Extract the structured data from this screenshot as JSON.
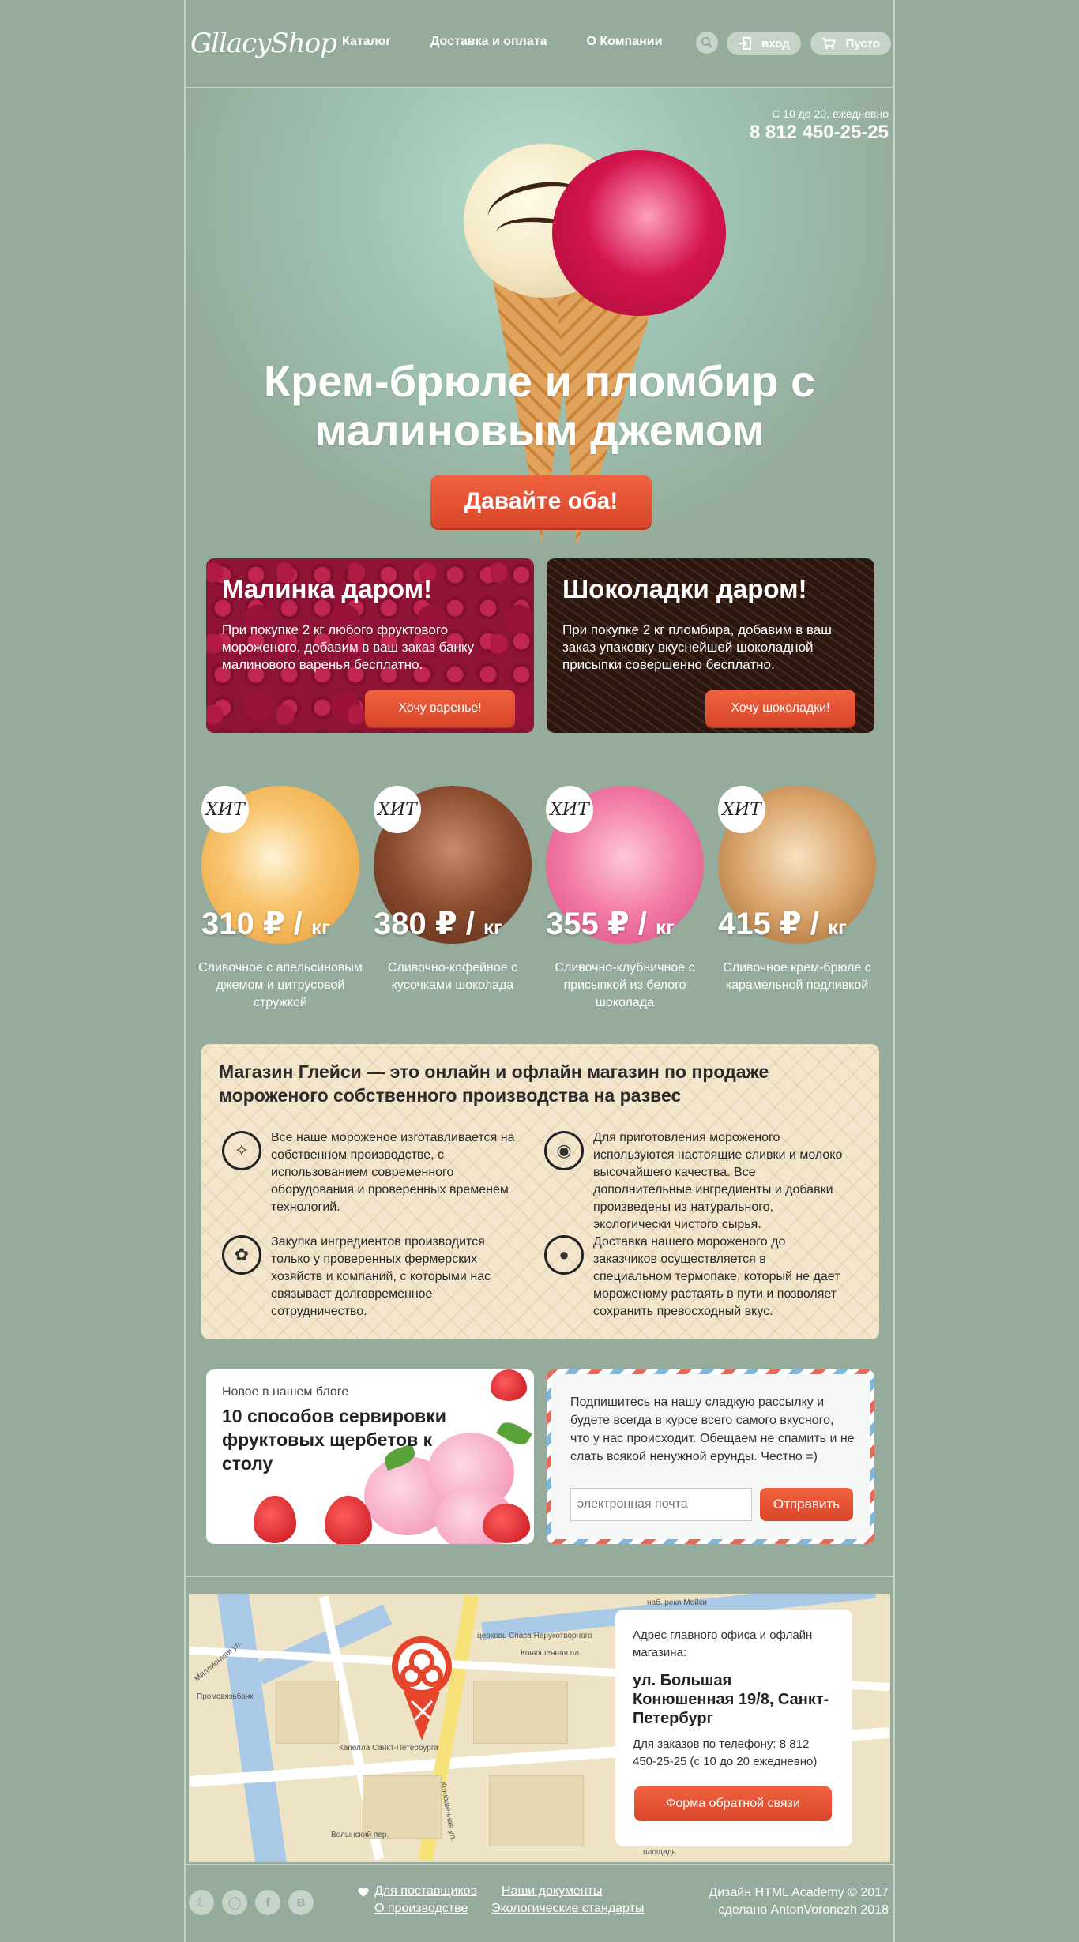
{
  "header": {
    "logo": "GllacyShop",
    "nav": [
      "Каталог",
      "Доставка и оплата",
      "О Компании"
    ],
    "login": "вход",
    "cart": "Пусто"
  },
  "hero": {
    "hours": "С 10 до 20, ежедневно",
    "phone": "8 812 450-25-25",
    "title": "Крем-брюле и пломбир с малиновым джемом",
    "button": "Давайте оба!"
  },
  "promos": [
    {
      "title": "Малинка даром!",
      "text": "При покупке 2 кг любого фруктового мороженого, добавим в ваш заказ банку малинового варенья бесплатно.",
      "button": "Хочу варенье!"
    },
    {
      "title": "Шоколадки даром!",
      "text": "При покупке 2 кг пломбира, добавим в ваш заказ упаковку вкуснейшей шоколадной присыпки совершенно бесплатно.",
      "button": "Хочу шоколадки!"
    }
  ],
  "products": [
    {
      "badge": "ХИТ",
      "price": "310 ₽ /",
      "unit": "кг",
      "name": "Сливочное с апельсиновым джемом и цитрусовой стружкой",
      "color": "#f5b04d"
    },
    {
      "badge": "ХИТ",
      "price": "380 ₽ /",
      "unit": "кг",
      "name": "Сливочно-кофейное с кусочками шоколада",
      "color": "#8a4a2e"
    },
    {
      "badge": "ХИТ",
      "price": "355 ₽ /",
      "unit": "кг",
      "name": "Сливочно-клубничное с присыпкой из белого шоколада",
      "color": "#f27aa5"
    },
    {
      "badge": "ХИТ",
      "price": "415 ₽ /",
      "unit": "кг",
      "name": "Сливочное крем-брюле с карамельной подливкой",
      "color": "#d9a46a"
    }
  ],
  "info": {
    "title": "Магазин Глейси — это онлайн и офлайн магазин по продаже мороженого собственного производства на развес",
    "features": [
      {
        "icon": "popsicle-icon",
        "text": "Все наше мороженое изготавливается на собственном производстве, с использованием современного оборудования и проверенных временем технологий."
      },
      {
        "icon": "cow-icon",
        "text": "Для приготовления мороженого используются настоящие сливки и молоко высочайшего качества. Все дополнительные ингредиенты и добавки произведены из натурального, экологически чистого сырья."
      },
      {
        "icon": "leaf-icon",
        "text": "Закупка ингредиентов производится только у проверенных фермерских хозяйств и компаний, с которыми нас связывает долговременное сотрудничество."
      },
      {
        "icon": "thermometer-icon",
        "text": "Доставка нашего мороженого до заказчиков осуществляется в специальном термопаке, который не дает мороженому растаять в пути и позволяет сохранить превосходный вкус."
      }
    ]
  },
  "blog": {
    "kicker": "Новое в нашем блоге",
    "title": "10 способов сервировки фруктовых щербетов к столу"
  },
  "subscribe": {
    "text": "Подпишитесь на нашу сладкую рассылку и будете всегда в курсе всего самого вкусного, что у нас происходит. Обещаем не спамить и не слать всякой ненужной ерунды. Честно =)",
    "placeholder": "электронная почта",
    "button": "Отправить"
  },
  "map": {
    "labels": [
      "наб. реки Мойки",
      "Конюшенная пл.",
      "церковь Спаса Нерукотворного",
      "Миллионная ул.",
      "Промсвязьбанк",
      "Капелла Санкт-Петербурга",
      "Конюшенная ул.",
      "Волынский пер.",
      "площадь"
    ],
    "card_label": "Адрес главного офиса и офлайн магазина:",
    "address": "ул. Большая Конюшенная 19/8, Санкт-Петербург",
    "phone_text": "Для заказов по телефону: 8 812 450-25-25 (с 10 до 20 ежедневно)",
    "button": "Форма обратной связи"
  },
  "footer": {
    "links": [
      "Для поставщиков",
      "Наши документы",
      "О производстве",
      "Экологические стандарты"
    ],
    "credit1": "Дизайн HTML Academy © 2017",
    "credit2": "сделано AntonVoronezh 2018",
    "socials": [
      "twitter-icon",
      "instagram-icon",
      "facebook-icon",
      "vk-icon"
    ]
  }
}
